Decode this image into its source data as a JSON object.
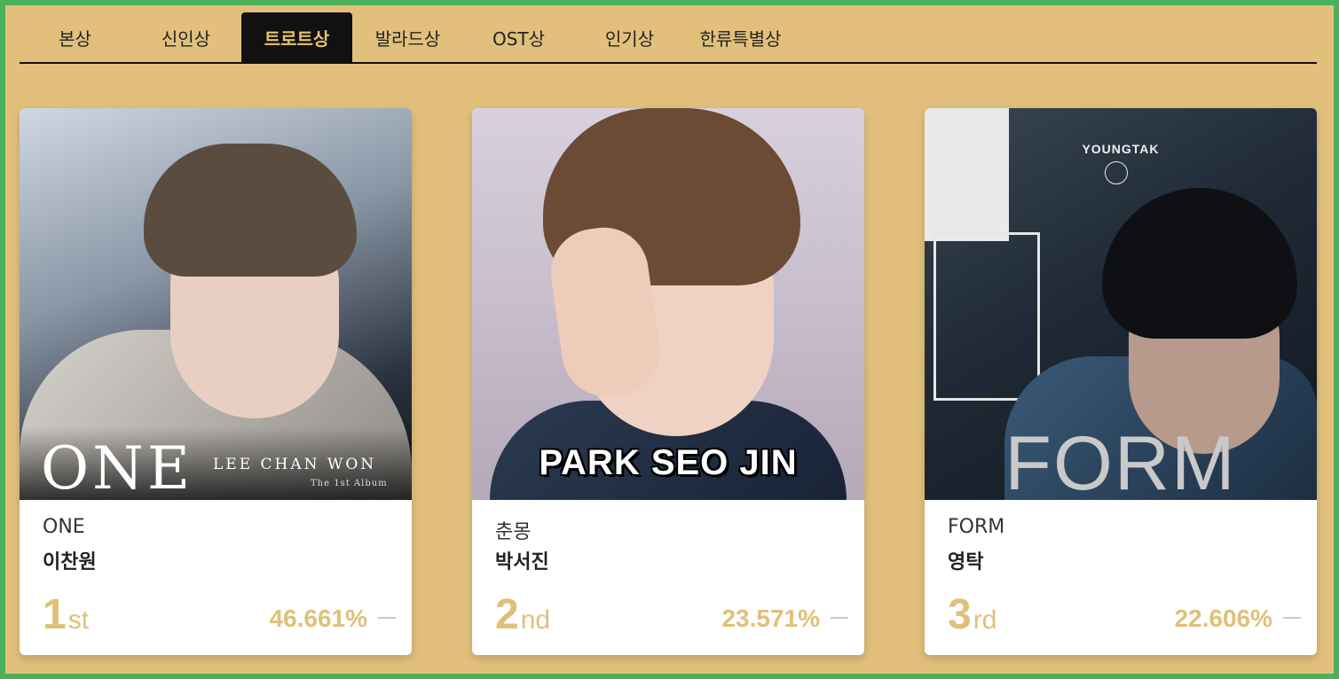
{
  "tabs": [
    {
      "label": "본상"
    },
    {
      "label": "신인상"
    },
    {
      "label": "트로트상",
      "active": true
    },
    {
      "label": "발라드상"
    },
    {
      "label": "OST상"
    },
    {
      "label": "인기상"
    },
    {
      "label": "한류특별상"
    }
  ],
  "cards": [
    {
      "cover": {
        "title": "ONE",
        "artist_en": "LEE CHAN WON",
        "subtitle": "The 1st Album"
      },
      "album": "ONE",
      "artist": "이찬원",
      "rank": "1",
      "rank_suffix": "st",
      "percent": "46.661%",
      "change": "—"
    },
    {
      "cover": {
        "title": "PARK SEO JIN"
      },
      "album": "춘몽",
      "artist": "박서진",
      "rank": "2",
      "rank_suffix": "nd",
      "percent": "23.571%",
      "change": "—"
    },
    {
      "cover": {
        "title": "FORM",
        "brand": "YOUNGTAK"
      },
      "album": "FORM",
      "artist": "영탁",
      "rank": "3",
      "rank_suffix": "rd",
      "percent": "22.606%",
      "change": "—"
    }
  ],
  "colors": {
    "background": "#e2c07c",
    "border": "#4caf5a",
    "accent": "#e0c079",
    "tab_active_bg": "#111111"
  }
}
